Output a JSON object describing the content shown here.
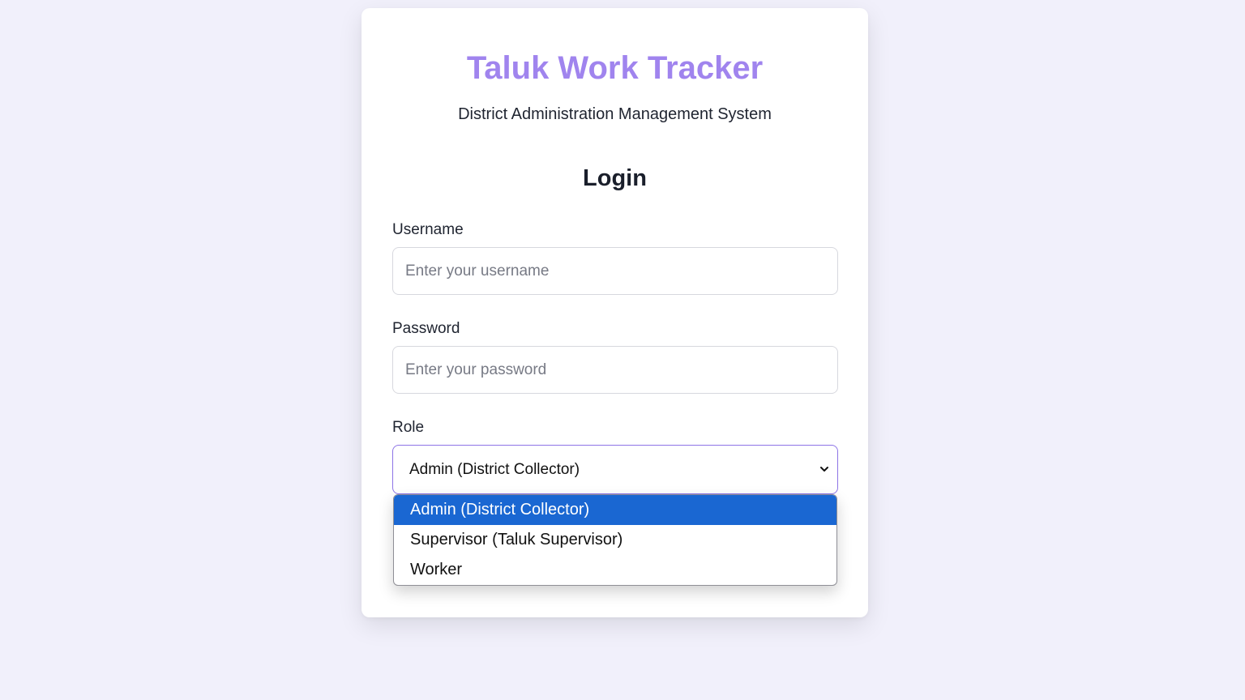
{
  "app": {
    "title": "Taluk Work Tracker",
    "subtitle": "District Administration Management System"
  },
  "form": {
    "heading": "Login",
    "username": {
      "label": "Username",
      "placeholder": "Enter your username",
      "value": ""
    },
    "password": {
      "label": "Password",
      "placeholder": "Enter your password",
      "value": ""
    },
    "role": {
      "label": "Role",
      "selected": "Admin (District Collector)",
      "options": [
        "Admin (District Collector)",
        "Supervisor (Taluk Supervisor)",
        "Worker"
      ],
      "selected_index": 0
    }
  },
  "colors": {
    "background": "#f1f0fb",
    "title_accent": "#a084ee",
    "select_focus_border": "#8d74e6",
    "option_highlight": "#1a67d2"
  },
  "icons": {
    "select_arrow": "chevron-down-icon"
  }
}
